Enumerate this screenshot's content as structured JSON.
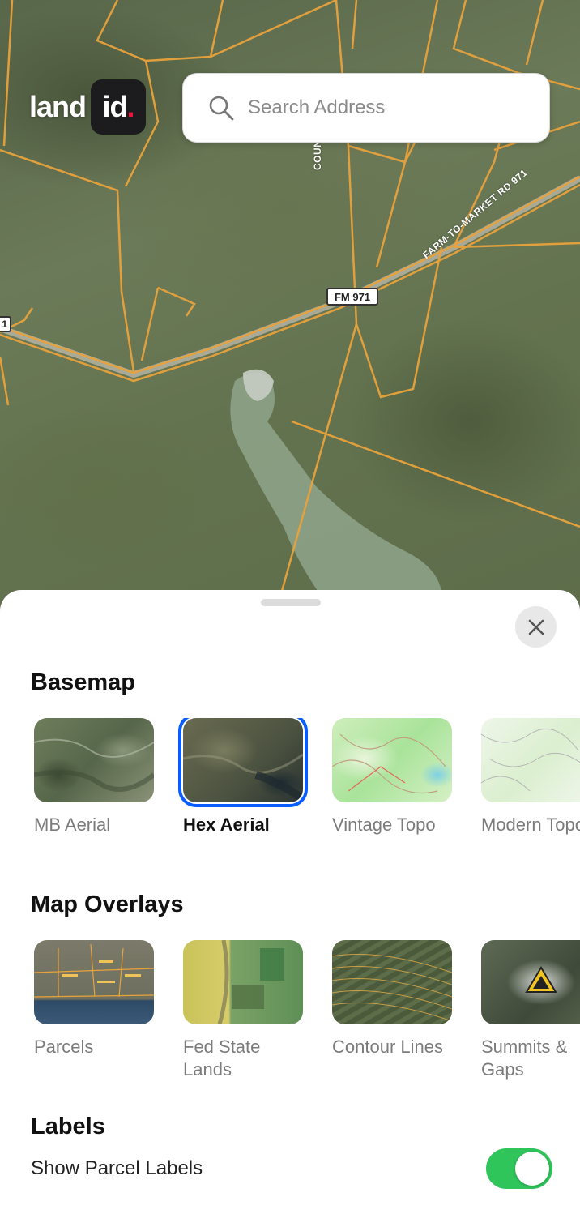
{
  "app": {
    "logo_word": "land",
    "logo_box": "id",
    "logo_dot": ".",
    "brand_accent": "#e8163c"
  },
  "search": {
    "placeholder": "Search Address",
    "value": ""
  },
  "map": {
    "road_shield": "FM 971",
    "road_shield_left": "1",
    "road_labels": {
      "county": "COUNTY RD",
      "farm": "FARM-TO-MARKET RD 971"
    }
  },
  "sheet": {
    "basemap": {
      "title": "Basemap",
      "items": [
        {
          "label": "MB Aerial",
          "selected": false
        },
        {
          "label": "Hex Aerial",
          "selected": true
        },
        {
          "label": "Vintage Topo",
          "selected": false
        },
        {
          "label": "Modern Topo",
          "selected": false
        }
      ]
    },
    "overlays": {
      "title": "Map Overlays",
      "items": [
        {
          "label": "Parcels"
        },
        {
          "label": "Fed State Lands"
        },
        {
          "label": "Contour Lines"
        },
        {
          "label": "Summits & Gaps"
        }
      ]
    },
    "labels": {
      "title": "Labels",
      "show_parcel_labels": "Show Parcel Labels",
      "show_parcel_labels_on": true
    },
    "colors": {
      "selected_outline": "#0a5cff",
      "toggle_on": "#2fc55a",
      "parcel_line": "#e8a33c"
    }
  }
}
